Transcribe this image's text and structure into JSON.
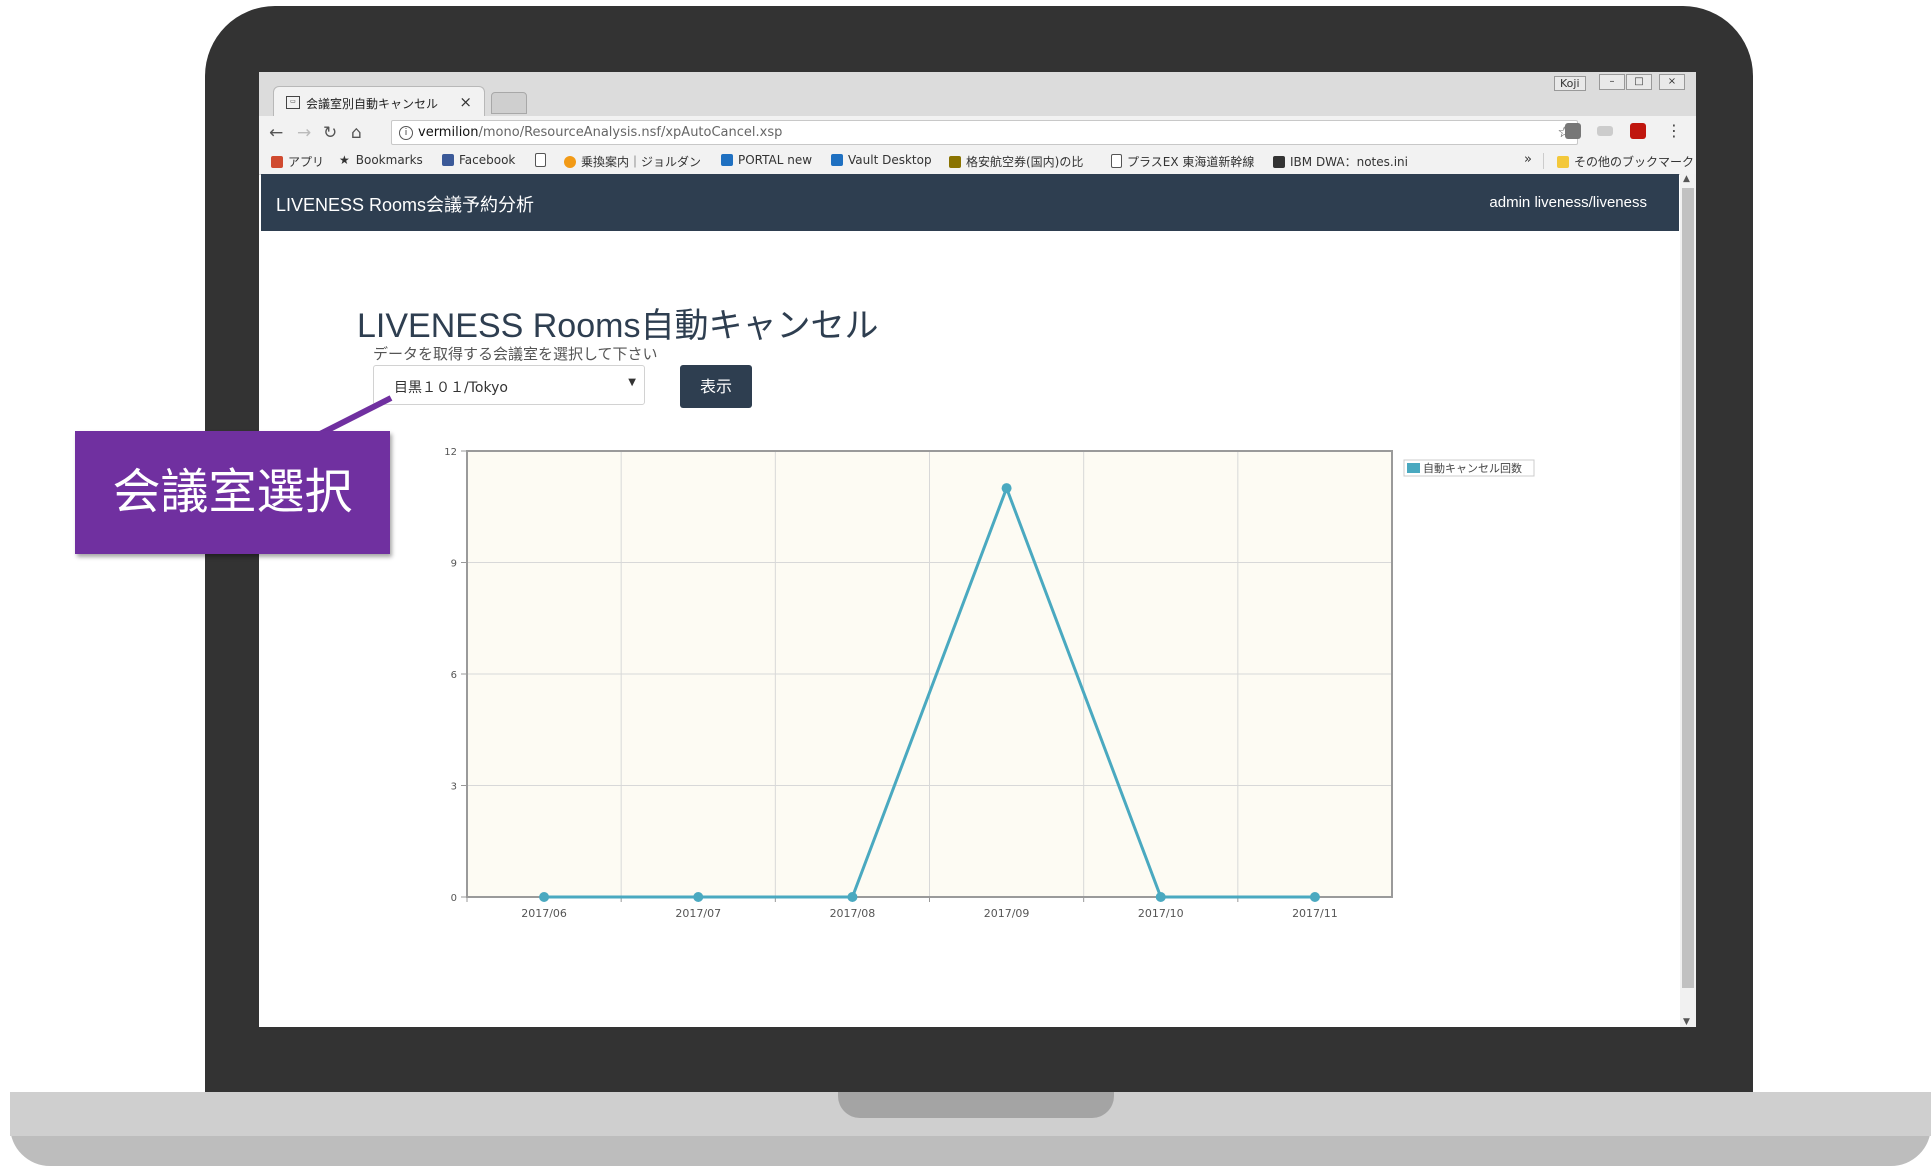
{
  "browser": {
    "tab_title": "会議室別自動キャンセル",
    "tab_close": "×",
    "window_user": "Koji",
    "window_controls": [
      "–",
      "□",
      "×"
    ],
    "url_host": "vermilion",
    "url_path": "/mono/ResourceAnalysis.nsf/xpAutoCancel.xsp",
    "bookmarks": [
      {
        "label": "アプリ",
        "icon": "apps-grid-icon",
        "color": "#d04a2f"
      },
      {
        "label": "Bookmarks",
        "icon": "star-icon",
        "color": "#333333"
      },
      {
        "label": "Facebook",
        "icon": "facebook-icon",
        "color": "#3b5998"
      },
      {
        "label": "",
        "icon": "page-icon",
        "color": "#555555"
      },
      {
        "label": "乗換案内｜ジョルダン",
        "icon": "jorudan-icon",
        "color": "#f29a16"
      },
      {
        "label": "PORTAL new",
        "icon": "ibm-bee-icon",
        "color": "#1f70c1"
      },
      {
        "label": "Vault Desktop",
        "icon": "ibm-bee-icon",
        "color": "#1f70c1"
      },
      {
        "label": "格安航空券(国内)の比",
        "icon": "plane-icon",
        "color": "#8a7300"
      },
      {
        "label": "プラスEX 東海道新幹線",
        "icon": "page-icon",
        "color": "#555555"
      },
      {
        "label": "IBM DWA：notes.ini",
        "icon": "dwa-icon",
        "color": "#333333"
      }
    ],
    "bookmarks_more": "»",
    "other_bookmarks": "その他のブックマーク"
  },
  "app": {
    "brand": "LIVENESS Rooms会議予約分析",
    "user": "admin liveness/liveness"
  },
  "page": {
    "title": "LIVENESS Rooms自動キャンセル",
    "room_label": "データを取得する会議室を選択して下さい",
    "room_selected": "目黒１０１/Tokyo",
    "show_button": "表示"
  },
  "callout": {
    "text": "会議室選択",
    "color": "#7030a0"
  },
  "chart_data": {
    "type": "line",
    "categories": [
      "2017/06",
      "2017/07",
      "2017/08",
      "2017/09",
      "2017/10",
      "2017/11"
    ],
    "series": [
      {
        "name": "自動キャンセル回数",
        "values": [
          0,
          0,
          0,
          11,
          0,
          0
        ],
        "color": "#4aa9c0"
      }
    ],
    "y_ticks": [
      "0",
      "3",
      "6",
      "9",
      "12"
    ],
    "ylim": [
      0,
      12
    ],
    "grid": true,
    "legend": "right",
    "background": "#fdfbf3"
  }
}
